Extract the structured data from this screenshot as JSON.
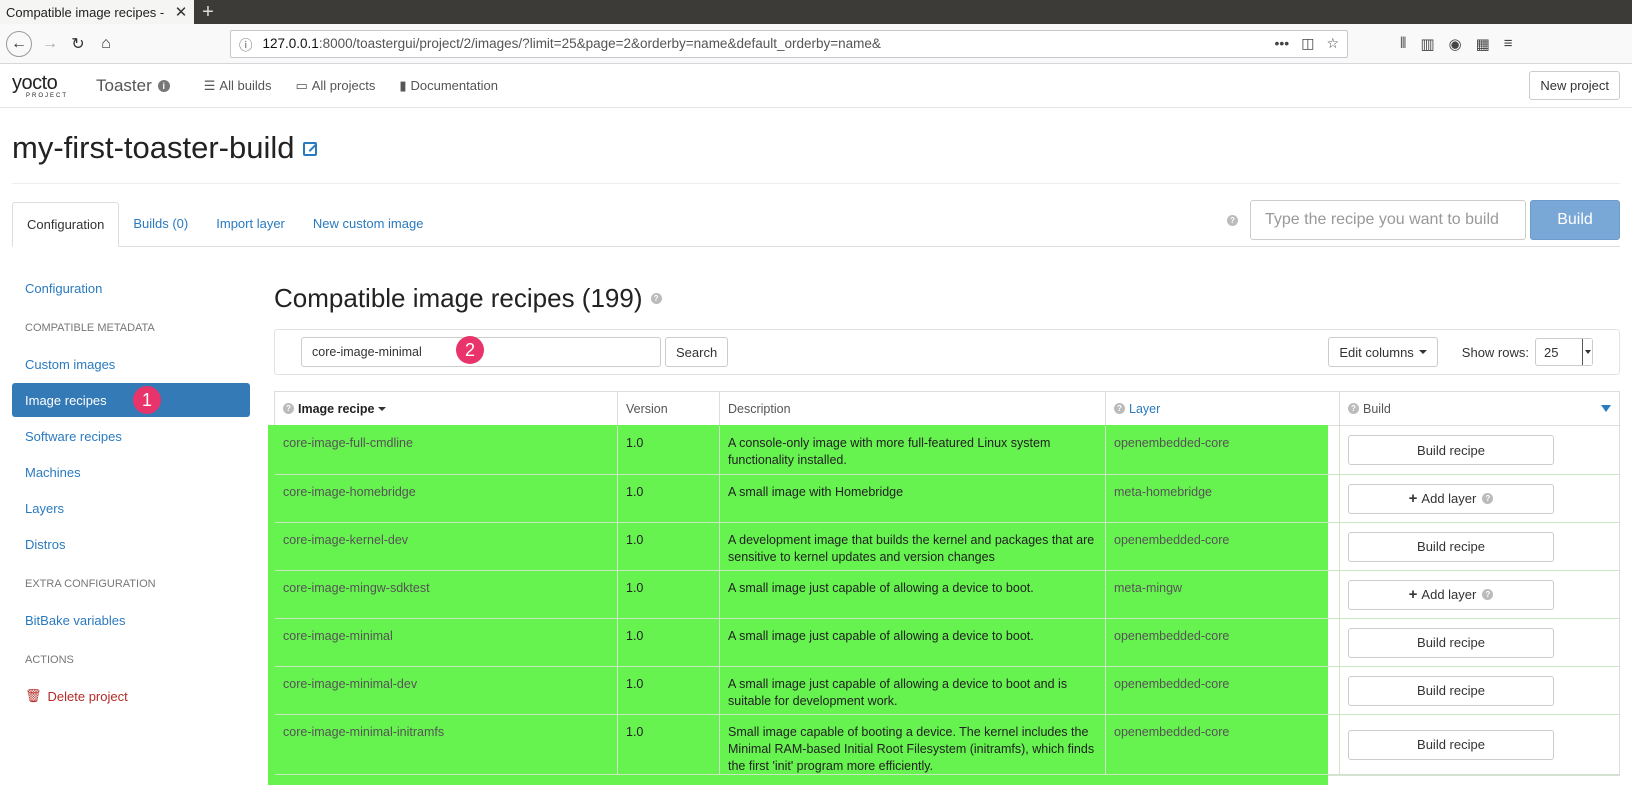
{
  "browser": {
    "tab_title": "Compatible image recipes - ",
    "url_host": "127.0.0.1",
    "url_path": ":8000/toastergui/project/2/images/?limit=25&page=2&orderby=name&default_orderby=name&"
  },
  "app": {
    "logo_main": "yocto",
    "logo_sub": "PROJECT",
    "title": "Toaster",
    "links": [
      "All builds",
      "All projects",
      "Documentation"
    ],
    "new_project": "New project"
  },
  "project": {
    "name": "my-first-toaster-build",
    "tabs": [
      "Configuration",
      "Builds (0)",
      "Import layer",
      "New custom image"
    ],
    "recipe_placeholder": "Type the recipe you want to build",
    "build_label": "Build"
  },
  "sidebar": {
    "configuration": "Configuration",
    "header_metadata": "COMPATIBLE METADATA",
    "custom_images": "Custom images",
    "image_recipes": "Image recipes",
    "software_recipes": "Software recipes",
    "machines": "Machines",
    "layers": "Layers",
    "distros": "Distros",
    "header_extra": "EXTRA CONFIGURATION",
    "bitbake_variables": "BitBake variables",
    "header_actions": "ACTIONS",
    "delete_project": "Delete project"
  },
  "main": {
    "heading": "Compatible image recipes (199)",
    "search_value": "core-image-minimal",
    "search_button": "Search",
    "edit_columns": "Edit columns",
    "show_rows_label": "Show rows:",
    "show_rows_value": "25",
    "badge1": "1",
    "badge2": "2"
  },
  "table": {
    "headers": [
      "Image recipe",
      "Version",
      "Description",
      "Layer",
      "Build"
    ],
    "rows": [
      {
        "recipe": "core-image-full-cmdline",
        "version": "1.0",
        "description": "A console-only image with more full-featured Linux system functionality installed.",
        "layer": "openembedded-core",
        "action": "Build recipe",
        "add": false
      },
      {
        "recipe": "core-image-homebridge",
        "version": "1.0",
        "description": "A small image with Homebridge",
        "layer": "meta-homebridge",
        "action": "Add layer",
        "add": true
      },
      {
        "recipe": "core-image-kernel-dev",
        "version": "1.0",
        "description": "A development image that builds the kernel and packages that are sensitive to kernel updates and version changes",
        "layer": "openembedded-core",
        "action": "Build recipe",
        "add": false
      },
      {
        "recipe": "core-image-mingw-sdktest",
        "version": "1.0",
        "description": "A small image just capable of allowing a device to boot.",
        "layer": "meta-mingw",
        "action": "Add layer",
        "add": true
      },
      {
        "recipe": "core-image-minimal",
        "version": "1.0",
        "description": "A small image just capable of allowing a device to boot.",
        "layer": "openembedded-core",
        "action": "Build recipe",
        "add": false
      },
      {
        "recipe": "core-image-minimal-dev",
        "version": "1.0",
        "description": "A small image just capable of allowing a device to boot and is suitable for development work.",
        "layer": "openembedded-core",
        "action": "Build recipe",
        "add": false
      },
      {
        "recipe": "core-image-minimal-initramfs",
        "version": "1.0",
        "description": "Small image capable of booting a device. The kernel includes the Minimal RAM-based Initial Root Filesystem (initramfs), which finds the first 'init' program more efficiently.",
        "layer": "openembedded-core",
        "action": "Build recipe",
        "add": false
      }
    ]
  },
  "colors": {
    "accent": "#337ab7",
    "highlight": "#66f24f",
    "badge": "#e8336b"
  }
}
